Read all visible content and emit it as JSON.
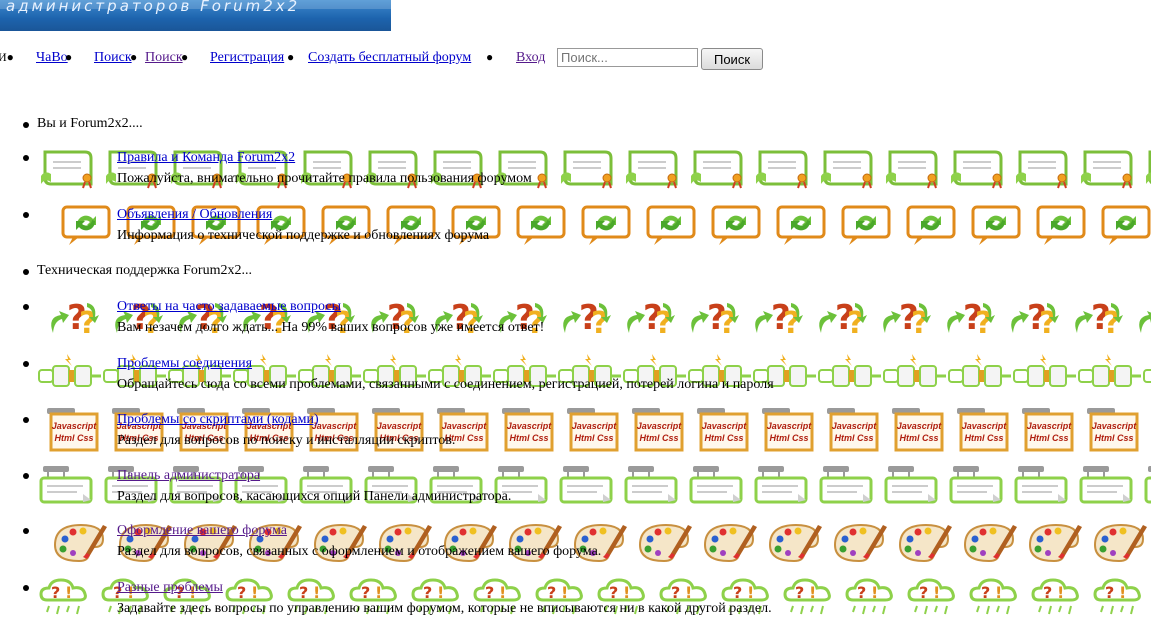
{
  "banner": {
    "text": "администраторов Forum2x2"
  },
  "nav": {
    "items": [
      {
        "label": "ЧаВо"
      },
      {
        "label": "Поиск"
      },
      {
        "label": "Поиск"
      },
      {
        "label": "Регистрация"
      },
      {
        "label": "Создать бесплатный форум"
      },
      {
        "label": "Вход"
      }
    ],
    "search_placeholder": "Поиск...",
    "search_button": "Поиск"
  },
  "categories": [
    {
      "label": "Вы и Forum2x2...."
    },
    {
      "label": "Техническая поддержка Forum2x2..."
    }
  ],
  "forums": [
    {
      "title": "Правила и Команда Forum2x2",
      "desc": "Пожалуйста, внимательно прочитайте правила пользования форумом",
      "icon": "rules-scroll-icon"
    },
    {
      "title": "Объявления / Обновления",
      "desc": "Информация о технической поддержке и обновлениях форума",
      "icon": "refresh-announcement-icon"
    },
    {
      "title": "Ответы на часто задаваемые вопросы",
      "desc": "Вам незачем долго ждать... На 99% ваших вопросов уже имеется ответ!",
      "icon": "faq-question-icon"
    },
    {
      "title": "Проблемы соединения",
      "desc": "Обращайтесь сюда со всеми проблемами, связанными с соединением, регистрацией, потерей логина и пароля",
      "icon": "connection-plug-icon"
    },
    {
      "title": "Проблемы со скриптами (кодами)",
      "desc": "Раздел для вопросов по поиску и инсталляции скриптов.",
      "icon": "script-code-icon",
      "icon_text": [
        "Javascript",
        "Html Css"
      ]
    },
    {
      "title": "Панель администратора",
      "desc": "Раздел для вопросов, касающихся опций Панели администратора.",
      "icon": "admin-panel-icon"
    },
    {
      "title": "Оформление вашего форума",
      "desc": "Раздел для вопросов, связанных с оформлением и отображением вашего форума.",
      "icon": "design-palette-icon"
    },
    {
      "title": "Разные проблемы",
      "desc": "Задавайте здесь вопросы по управлению вашим форумом, которые не вписываются ни в какой другой раздел.",
      "icon": "misc-cloud-icon"
    }
  ]
}
